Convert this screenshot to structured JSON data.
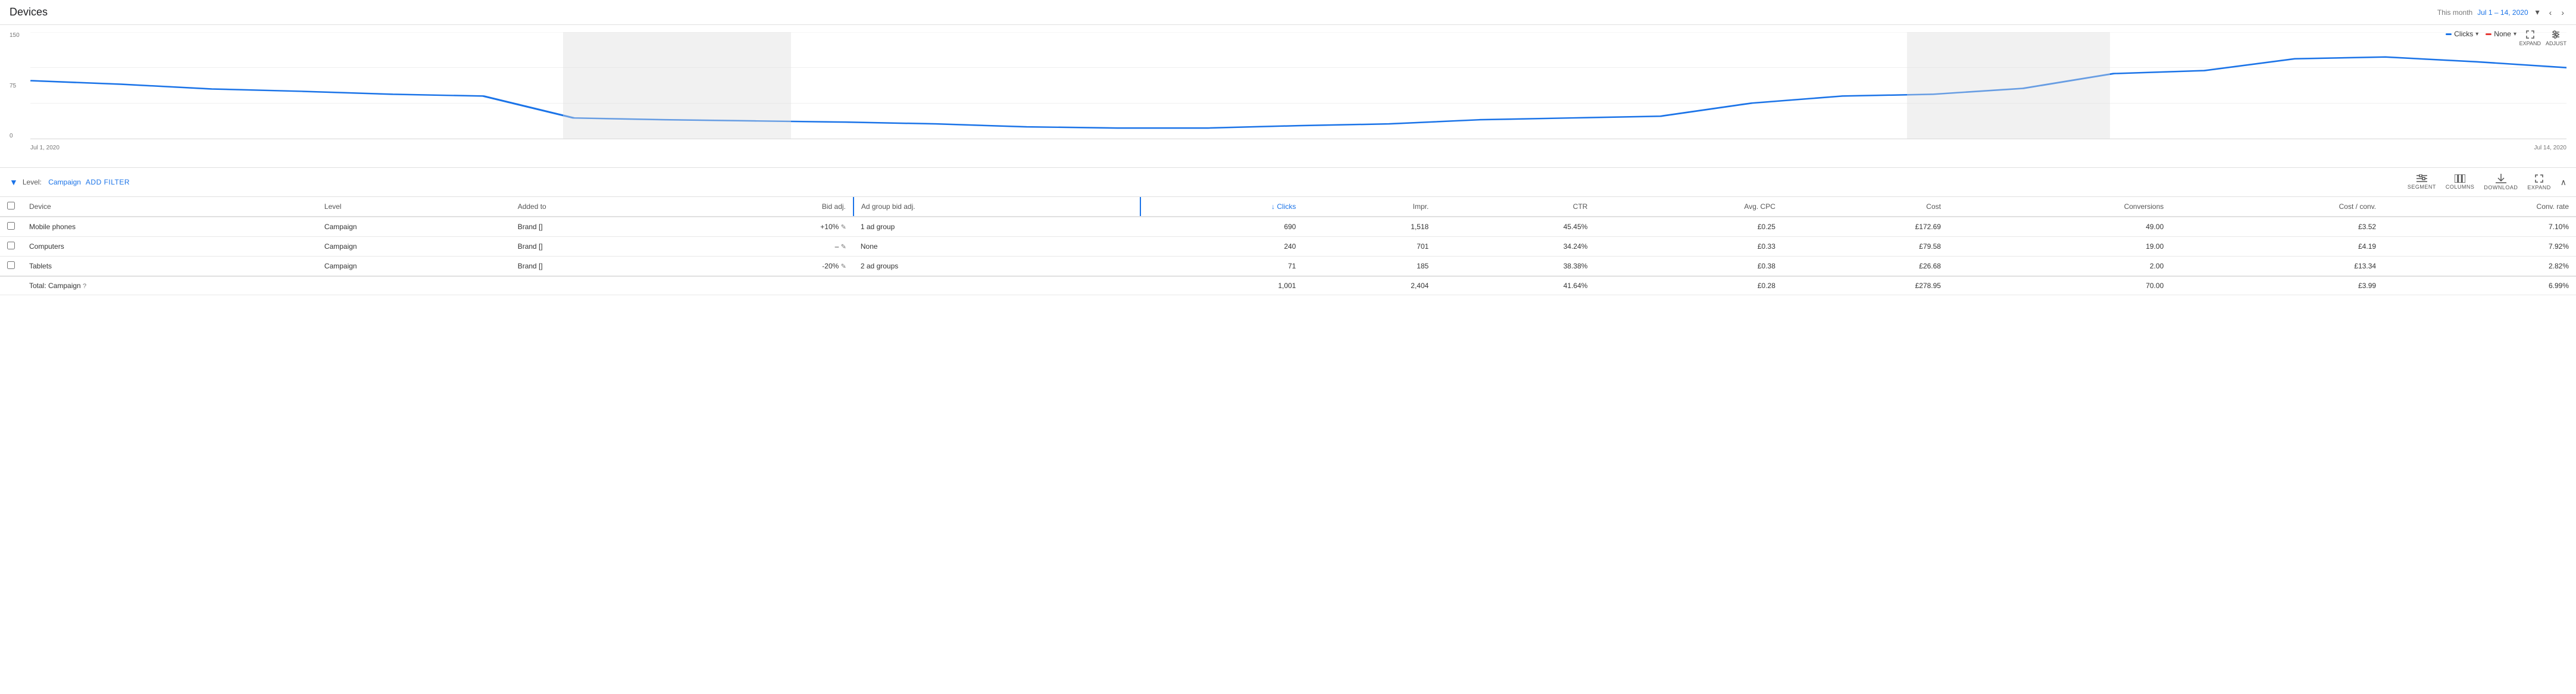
{
  "header": {
    "title": "Devices",
    "date_label": "This month",
    "date_value": "Jul 1 – 14, 2020"
  },
  "chart": {
    "legend": {
      "metric1": "Clicks",
      "metric2": "None"
    },
    "y_labels": [
      "150",
      "75",
      "0"
    ],
    "x_labels": [
      "Jul 1, 2020",
      "Jul 14, 2020"
    ],
    "expand_label": "EXPAND",
    "adjust_label": "ADJUST"
  },
  "filter": {
    "level_label": "Level:",
    "level_value": "Campaign",
    "add_filter": "ADD FILTER"
  },
  "toolbar": {
    "segment_label": "SEGMENT",
    "columns_label": "COLUMNS",
    "download_label": "DOWNLOAD",
    "expand_label": "EXPAND"
  },
  "table": {
    "columns": [
      {
        "key": "checkbox",
        "label": ""
      },
      {
        "key": "device",
        "label": "Device"
      },
      {
        "key": "level",
        "label": "Level"
      },
      {
        "key": "added_to",
        "label": "Added to"
      },
      {
        "key": "bid_adj",
        "label": "Bid adj."
      },
      {
        "key": "ad_group_bid",
        "label": "Ad group bid adj."
      },
      {
        "key": "clicks",
        "label": "Clicks",
        "sorted": true
      },
      {
        "key": "impr",
        "label": "Impr."
      },
      {
        "key": "ctr",
        "label": "CTR"
      },
      {
        "key": "avg_cpc",
        "label": "Avg. CPC"
      },
      {
        "key": "cost",
        "label": "Cost"
      },
      {
        "key": "conversions",
        "label": "Conversions"
      },
      {
        "key": "cost_conv",
        "label": "Cost / conv."
      },
      {
        "key": "conv_rate",
        "label": "Conv. rate"
      }
    ],
    "rows": [
      {
        "device": "Mobile phones",
        "level": "Campaign",
        "added_to": "Brand []",
        "bid_adj": "+10%",
        "ad_group_bid": "1 ad group",
        "clicks": "690",
        "impr": "1,518",
        "ctr": "45.45%",
        "avg_cpc": "£0.25",
        "cost": "£172.69",
        "conversions": "49.00",
        "cost_conv": "£3.52",
        "conv_rate": "7.10%"
      },
      {
        "device": "Computers",
        "level": "Campaign",
        "added_to": "Brand []",
        "bid_adj": "–",
        "ad_group_bid": "None",
        "clicks": "240",
        "impr": "701",
        "ctr": "34.24%",
        "avg_cpc": "£0.33",
        "cost": "£79.58",
        "conversions": "19.00",
        "cost_conv": "£4.19",
        "conv_rate": "7.92%"
      },
      {
        "device": "Tablets",
        "level": "Campaign",
        "added_to": "Brand []",
        "bid_adj": "-20%",
        "ad_group_bid": "2 ad groups",
        "clicks": "71",
        "impr": "185",
        "ctr": "38.38%",
        "avg_cpc": "£0.38",
        "cost": "£26.68",
        "conversions": "2.00",
        "cost_conv": "£13.34",
        "conv_rate": "2.82%"
      }
    ],
    "total_row": {
      "label": "Total: Campaign",
      "clicks": "1,001",
      "impr": "2,404",
      "ctr": "41.64%",
      "avg_cpc": "£0.28",
      "cost": "£278.95",
      "conversions": "70.00",
      "cost_conv": "£3.99",
      "conv_rate": "6.99%"
    }
  }
}
